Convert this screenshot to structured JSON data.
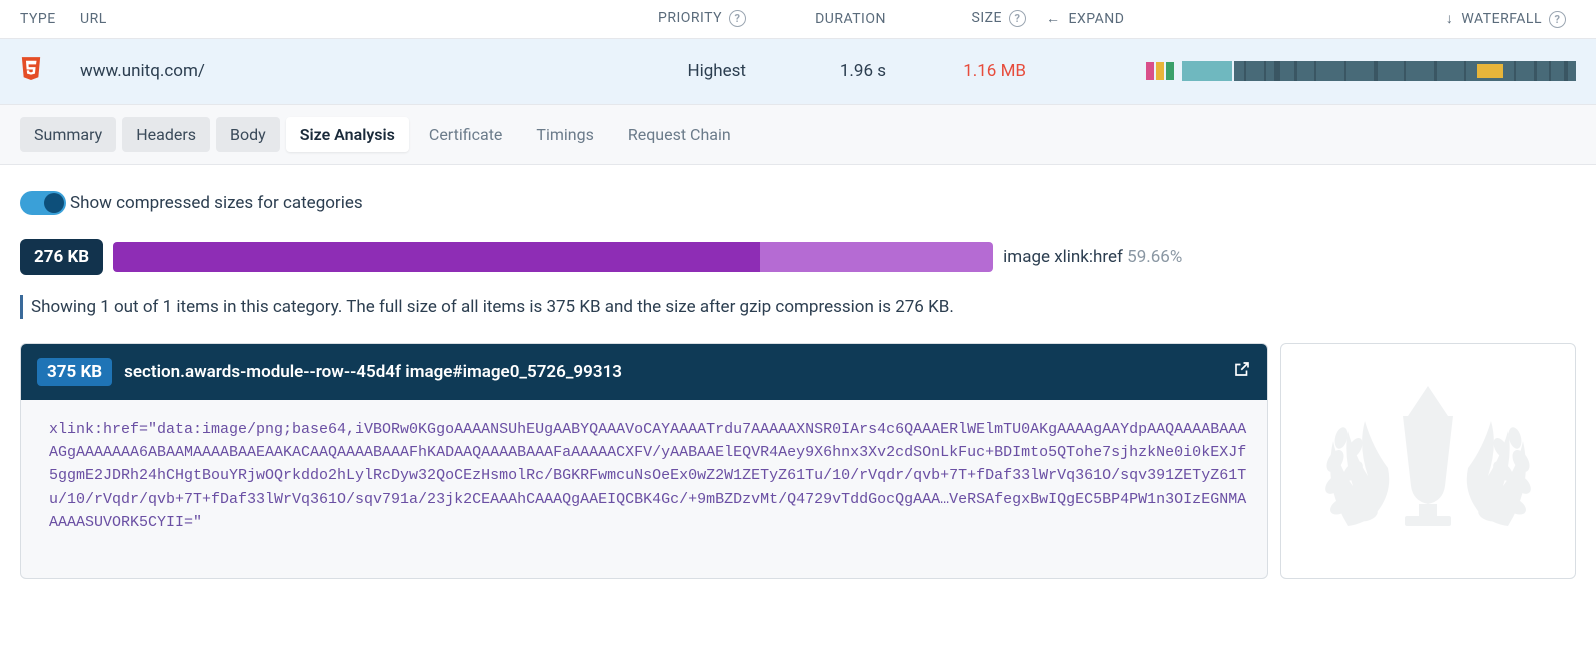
{
  "header": {
    "type": "TYPE",
    "url": "URL",
    "priority": "PRIORITY",
    "duration": "DURATION",
    "size": "SIZE",
    "expand": "EXPAND",
    "waterfall": "WATERFALL"
  },
  "row": {
    "url": "www.unitq.com/",
    "priority": "Highest",
    "duration": "1.96 s",
    "size": "1.16 MB"
  },
  "tabs": {
    "summary": "Summary",
    "headers": "Headers",
    "body": "Body",
    "size_analysis": "Size Analysis",
    "certificate": "Certificate",
    "timings": "Timings",
    "request_chain": "Request Chain"
  },
  "toggle_label": "Show compressed sizes for categories",
  "size_badge": "276 KB",
  "size_bar": {
    "dark_pct": 73.5,
    "light_pct": 26.5,
    "label": "image xlink:href",
    "pct_text": "59.66%"
  },
  "info_line": "Showing 1 out of 1 items in this category. The full size of all items is 375 KB and the size after gzip compression is 276 KB.",
  "item": {
    "size": "375 KB",
    "title": "section.awards-module--row--45d4f image#image0_5726_99313",
    "body": "xlink:href=\"data:image/png;base64,iVBORw0KGgoAAAANSUhEUgAABYQAAAVoCAYAAAATrdu7AAAAAXNSR0IArs4c6QAAAERlWElmTU0AKgAAAAgAAYdpAAQAAAABAAAAGgAAAAAAA6ABAAMAAAABAAEAAKACAAQAAAABAAAFhKADAAQAAAABAAAFaAAAAACXFV/yAABAAElEQVR4Aey9X6hnx3Xv2cdSOnLkFuc+BDImto5QTohe7sjhzkNe0i0kEXJf5ggmE2JDRh24hCHgtBouYRjwOQrkddo2hLylRcDyw32QoCEzHsmolRc/BGKRFwmcuNsOeEx0wZ2W1ZETyZ61Tu/10/rVqdr/qvb+7T+fDaf33lWrVq361O/sqv391ZETyZ61Tu/10/rVqdr/qvb+7T+fDaf33lWrVq361O/sqv791a/23jk2CEAAAhCAAAQgAAEIQCBK4Gc/+9mBZDzvMt/Q4729vTddGocQgAAA…VeRSAfegxBwIQgEC5BP4PW1n3OIzEGNMAAAAASUVORK5CYII=\""
  }
}
